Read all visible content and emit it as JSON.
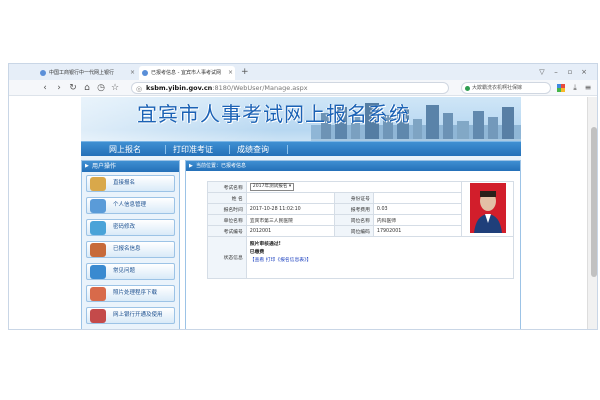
{
  "browser": {
    "tabs": [
      {
        "label": "中国工商银行中一代网上银行"
      },
      {
        "label": "已报考信息 - 宜宾市人事考试网"
      }
    ],
    "url_host": "ksbm.yibin.gov.cn",
    "url_path": ":8180/WebUser/Manage.aspx",
    "search_text": "大欺霸洗衣机啊社保嫁"
  },
  "site": {
    "title": "宜宾市人事考试网上报名系统",
    "menu": [
      "网上报名",
      "打印准考证",
      "成绩查询"
    ]
  },
  "sidebar": {
    "header": "用户操作",
    "items": [
      {
        "label": "直接报名",
        "icon": "register-icon",
        "color": "#d9a84a"
      },
      {
        "label": "个人信息管理",
        "icon": "user-icon",
        "color": "#5a9bd8"
      },
      {
        "label": "密码修改",
        "icon": "key-icon",
        "color": "#4aa3d8"
      },
      {
        "label": "已报名信息",
        "icon": "document-icon",
        "color": "#c76a3a"
      },
      {
        "label": "常见问题",
        "icon": "help-icon",
        "color": "#3a8ad0"
      },
      {
        "label": "照片处理程序下载",
        "icon": "people-icon",
        "color": "#d86a4a"
      },
      {
        "label": "网上银行开通及使用",
        "icon": "bank-icon",
        "color": "#c44a4a"
      }
    ]
  },
  "main": {
    "header": "当前位置：已报考信息",
    "fields": {
      "exam_label": "考试名称",
      "exam_value": "2017年测试报名",
      "name_label": "姓 名",
      "name_value": "",
      "id_label": "身份证号",
      "id_value": "",
      "time_label": "报名时间",
      "time_value": "2017-10-28 11:02:10",
      "fee_label": "报考费用",
      "fee_value": "0.03",
      "unit_label": "单位名称",
      "unit_value": "宜宾市第三人民医院",
      "post_label": "岗位名称",
      "post_value": "内科医师",
      "code_label": "考试编号",
      "code_value": "2012001",
      "postcode_label": "岗位编码",
      "postcode_value": "17902001",
      "status_label": "状态信息",
      "status_line1": "照片审核通过!",
      "status_line2": "已缴费",
      "status_line3": "【查看 打印《报名信息表》】"
    }
  }
}
